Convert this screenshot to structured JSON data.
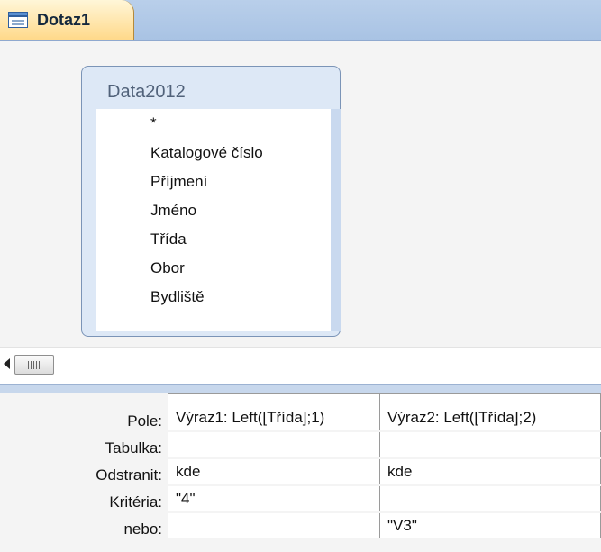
{
  "tab": {
    "title": "Dotaz1",
    "icon": "query-design-icon"
  },
  "table": {
    "name": "Data2012",
    "fields": [
      "*",
      "Katalogové číslo",
      "Příjmení",
      "Jméno",
      "Třída",
      "Obor",
      "Bydliště"
    ]
  },
  "grid": {
    "row_labels": [
      "Pole:",
      "Tabulka:",
      "Odstranit:",
      "Kritéria:",
      "nebo:"
    ],
    "columns": [
      {
        "field": "Výraz1: Left([Třída];1)",
        "table": "",
        "delete": "kde",
        "criteria": "\"4\"",
        "or": ""
      },
      {
        "field": "Výraz2: Left([Třída];2)",
        "table": "",
        "delete": "kde",
        "criteria": "",
        "or": "\"V3\""
      }
    ]
  },
  "icons": {
    "scroll_left": "scroll-left-arrow-icon",
    "scroll_thumb": "scroll-thumb-grip-icon"
  },
  "colors": {
    "tab_active": "#ffd98a",
    "table_frame": "#7b94b7",
    "strip": "#b9cfea"
  }
}
